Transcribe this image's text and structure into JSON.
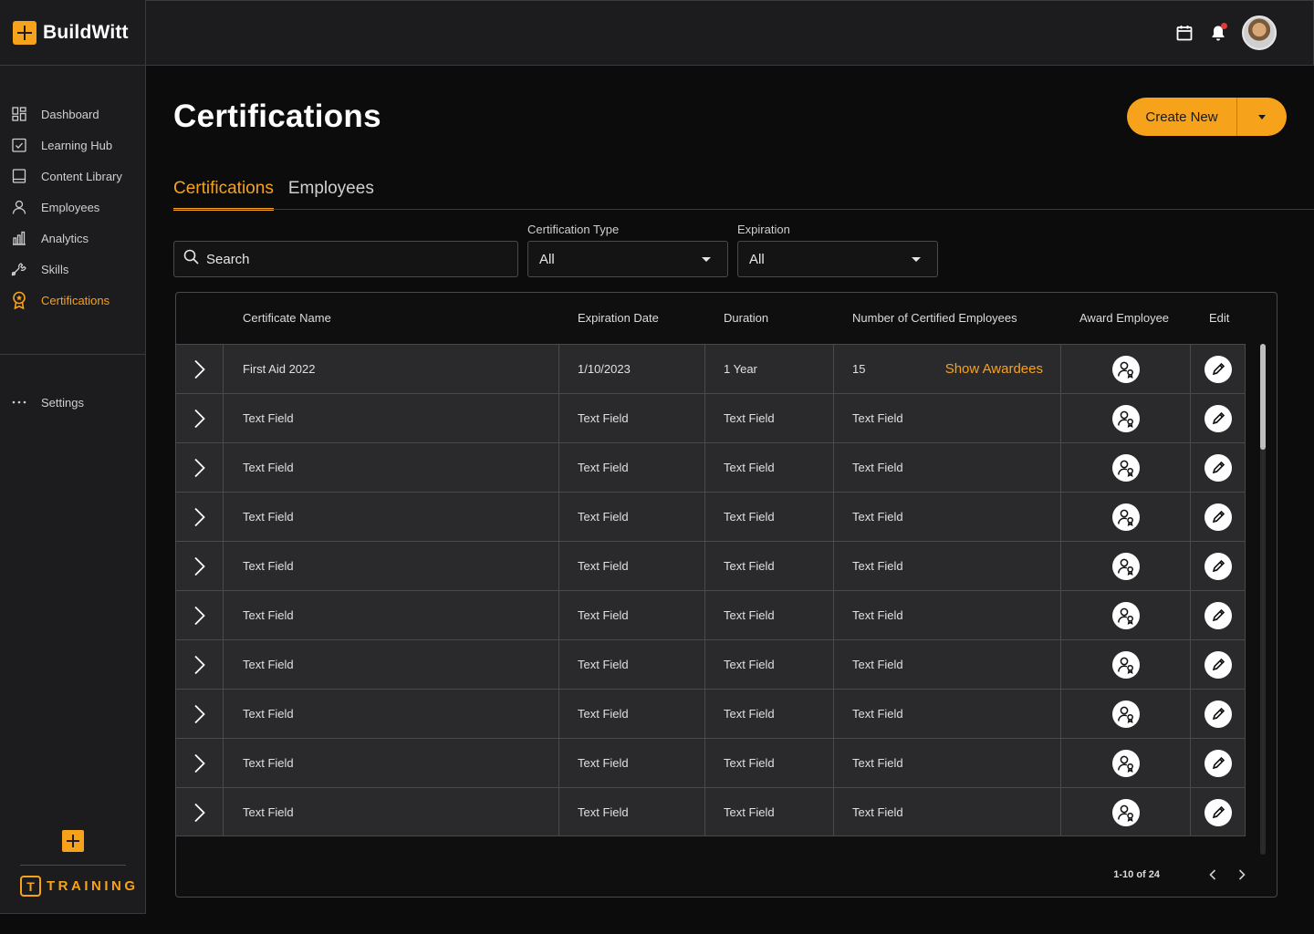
{
  "brand": {
    "name": "BuildWitt",
    "product": "TRAINING",
    "accent": "#f7a21b"
  },
  "sidebar": {
    "items": [
      {
        "label": "Dashboard",
        "icon": "dashboard-icon"
      },
      {
        "label": "Learning Hub",
        "icon": "checkbox-icon"
      },
      {
        "label": "Content Library",
        "icon": "book-icon"
      },
      {
        "label": "Employees",
        "icon": "user-icon"
      },
      {
        "label": "Analytics",
        "icon": "bar-chart-icon"
      },
      {
        "label": "Skills",
        "icon": "tools-icon"
      },
      {
        "label": "Certifications",
        "icon": "award-icon",
        "active": true
      }
    ],
    "settings_label": "Settings"
  },
  "page": {
    "title": "Certifications",
    "create_button": "Create New",
    "tabs": [
      {
        "label": "Certifications",
        "active": true
      },
      {
        "label": "Employees",
        "active": false
      }
    ]
  },
  "filters": {
    "search_placeholder": "Search",
    "cert_type": {
      "label": "Certification Type",
      "value": "All"
    },
    "expiration": {
      "label": "Expiration",
      "value": "All"
    }
  },
  "table": {
    "headers": {
      "name": "Certificate Name",
      "expiration": "Expiration Date",
      "duration": "Duration",
      "number": "Number of Certified Employees",
      "award": "Award Employee",
      "edit": "Edit"
    },
    "show_awardees": "Show Awardees",
    "rows": [
      {
        "name": "First Aid 2022",
        "expiration": "1/10/2023",
        "duration": "1 Year",
        "number": "15"
      },
      {
        "name": "Text Field",
        "expiration": "Text Field",
        "duration": "Text Field",
        "number": "Text Field"
      },
      {
        "name": "Text Field",
        "expiration": "Text Field",
        "duration": "Text Field",
        "number": "Text Field"
      },
      {
        "name": "Text Field",
        "expiration": "Text Field",
        "duration": "Text Field",
        "number": "Text Field"
      },
      {
        "name": "Text Field",
        "expiration": "Text Field",
        "duration": "Text Field",
        "number": "Text Field"
      },
      {
        "name": "Text Field",
        "expiration": "Text Field",
        "duration": "Text Field",
        "number": "Text Field"
      },
      {
        "name": "Text Field",
        "expiration": "Text Field",
        "duration": "Text Field",
        "number": "Text Field"
      },
      {
        "name": "Text Field",
        "expiration": "Text Field",
        "duration": "Text Field",
        "number": "Text Field"
      },
      {
        "name": "Text Field",
        "expiration": "Text Field",
        "duration": "Text Field",
        "number": "Text Field"
      },
      {
        "name": "Text Field",
        "expiration": "Text Field",
        "duration": "Text Field",
        "number": "Text Field"
      }
    ],
    "pagination": "1-10 of 24"
  }
}
